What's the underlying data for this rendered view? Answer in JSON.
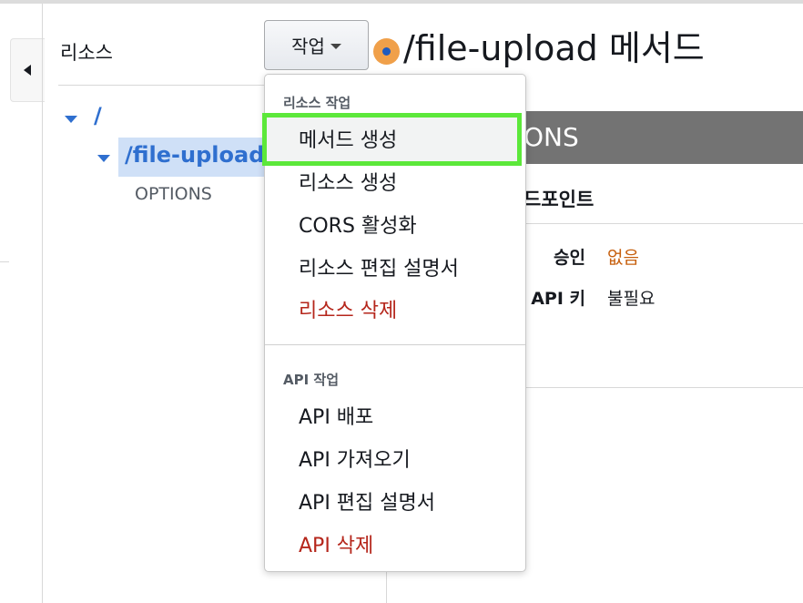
{
  "sidebar": {
    "resources_title": "리소스"
  },
  "actions": {
    "button_label": "작업"
  },
  "page": {
    "title": "/file-upload 메서드"
  },
  "tree": {
    "root": "/",
    "child": "/file-upload",
    "method": "OPTIONS"
  },
  "detail": {
    "method_header": "ONS",
    "endpoint_label": "드포인트",
    "rows": [
      {
        "key": "승인",
        "value": "없음"
      },
      {
        "key": "API 키",
        "value": "불필요"
      }
    ]
  },
  "dropdown": {
    "resource_group_label": "리소스 작업",
    "resource_items": [
      "메서드 생성",
      "리소스 생성",
      "CORS 활성화",
      "리소스 편집 설명서",
      "리소스 삭제"
    ],
    "api_group_label": "API 작업",
    "api_items": [
      "API 배포",
      "API 가져오기",
      "API 편집 설명서",
      "API 삭제"
    ]
  },
  "colors": {
    "link_blue": "#2f6fcf",
    "danger_red": "#b5261b",
    "highlight_green": "#5ce83a",
    "value_orange": "#c7600f"
  }
}
